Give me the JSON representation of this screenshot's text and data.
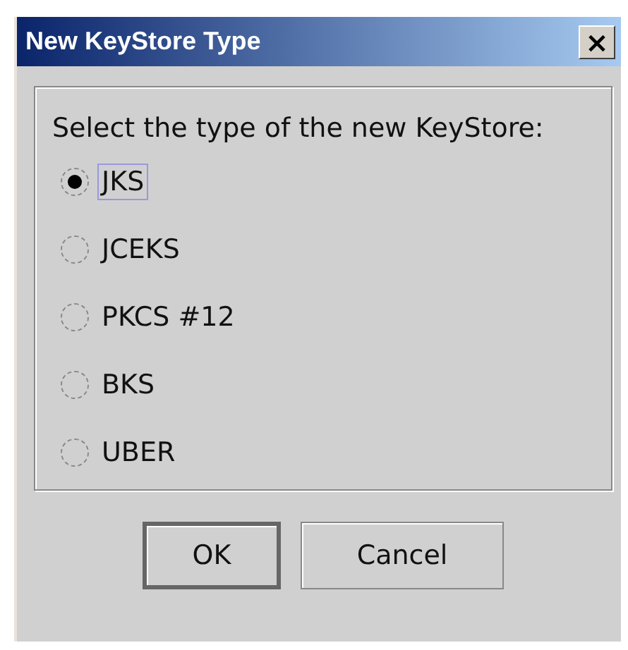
{
  "window": {
    "title": "New KeyStore Type",
    "close": "×"
  },
  "prompt": "Select the type of the new KeyStore:",
  "options": [
    {
      "label": "JKS",
      "selected": true
    },
    {
      "label": "JCEKS",
      "selected": false
    },
    {
      "label": "PKCS #12",
      "selected": false
    },
    {
      "label": "BKS",
      "selected": false
    },
    {
      "label": "UBER",
      "selected": false
    }
  ],
  "buttons": [
    {
      "label": "OK",
      "default": true
    },
    {
      "label": "Cancel",
      "default": false
    }
  ]
}
